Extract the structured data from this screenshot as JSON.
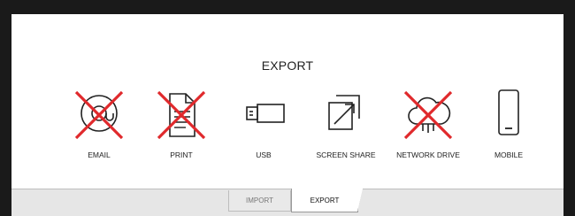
{
  "dialog": {
    "title": "EXPORT"
  },
  "options": [
    {
      "label": "EMAIL",
      "icon": "email-icon",
      "disabled": true
    },
    {
      "label": "PRINT",
      "icon": "print-icon",
      "disabled": true
    },
    {
      "label": "USB",
      "icon": "usb-icon",
      "disabled": false
    },
    {
      "label": "SCREEN SHARE",
      "icon": "screen-share-icon",
      "disabled": false
    },
    {
      "label": "NETWORK DRIVE",
      "icon": "network-drive-icon",
      "disabled": true
    },
    {
      "label": "MOBILE",
      "icon": "mobile-icon",
      "disabled": false
    }
  ],
  "tabs": [
    {
      "label": "IMPORT",
      "active": false
    },
    {
      "label": "EXPORT",
      "active": true
    }
  ],
  "colors": {
    "disabled_cross": "#e0292c",
    "icon_stroke": "#222222"
  }
}
